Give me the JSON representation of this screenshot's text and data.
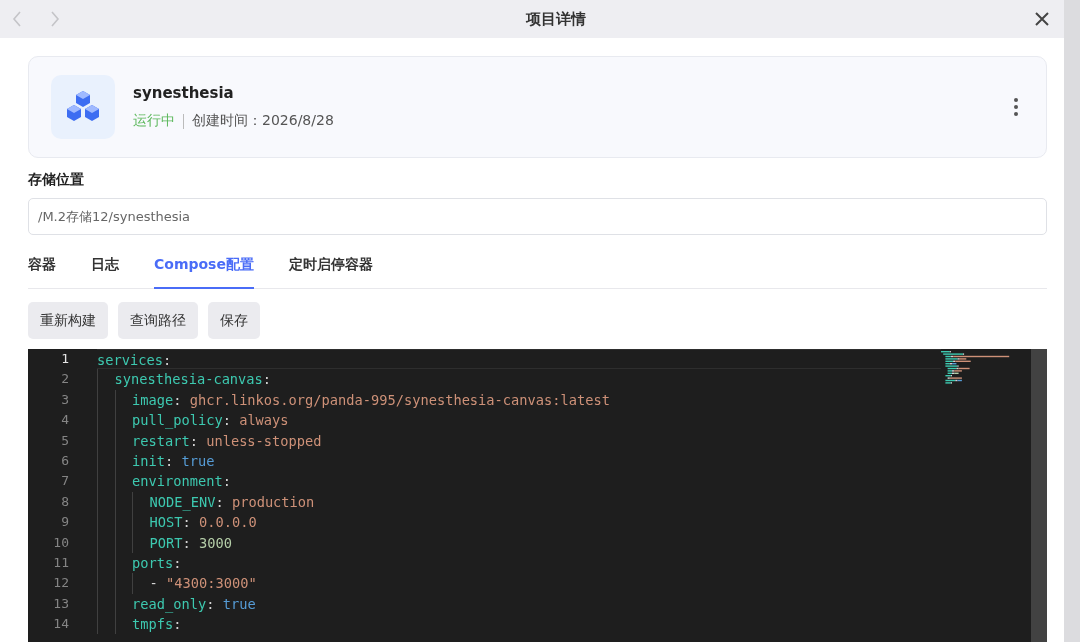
{
  "window": {
    "title": "项目详情"
  },
  "project": {
    "name": "synesthesia",
    "status": "运行中",
    "running": true,
    "created": "创建时间：2026/8/28"
  },
  "storage": {
    "label": "存储位置",
    "value": "/M.2存储12/synesthesia"
  },
  "tabs": [
    {
      "label": "容器",
      "selected": false
    },
    {
      "label": "日志",
      "selected": false
    },
    {
      "label": "Compose配置",
      "selected": true
    },
    {
      "label": "定时启停容器",
      "selected": false
    }
  ],
  "buttons": [
    "重新构建",
    "查询路径",
    "保存"
  ],
  "editor": {
    "lines": [
      {
        "number": "1",
        "current": true,
        "tokens": [
          {
            "kind": "key",
            "text": "services"
          },
          {
            "kind": "punct",
            "text": ":"
          }
        ],
        "children": [
          {
            "number": "2",
            "current": false,
            "tokens": [
              {
                "kind": "key",
                "text": "synesthesia-canvas"
              },
              {
                "kind": "punct",
                "text": ":"
              }
            ],
            "children": [
              {
                "number": "3",
                "current": false,
                "tokens": [
                  {
                    "kind": "key",
                    "text": "image"
                  },
                  {
                    "kind": "punct",
                    "text": ": "
                  },
                  {
                    "kind": "string",
                    "text": "ghcr.linkos.org/panda-995/synesthesia-canvas:latest"
                  }
                ]
              },
              {
                "number": "4",
                "current": false,
                "tokens": [
                  {
                    "kind": "key",
                    "text": "pull_policy"
                  },
                  {
                    "kind": "punct",
                    "text": ": "
                  },
                  {
                    "kind": "string",
                    "text": "always"
                  }
                ]
              },
              {
                "number": "5",
                "current": false,
                "tokens": [
                  {
                    "kind": "key",
                    "text": "restart"
                  },
                  {
                    "kind": "punct",
                    "text": ": "
                  },
                  {
                    "kind": "string",
                    "text": "unless-stopped"
                  }
                ]
              },
              {
                "number": "6",
                "current": false,
                "tokens": [
                  {
                    "kind": "key",
                    "text": "init"
                  },
                  {
                    "kind": "punct",
                    "text": ": "
                  },
                  {
                    "kind": "bool",
                    "text": "true"
                  }
                ]
              },
              {
                "number": "7",
                "current": false,
                "tokens": [
                  {
                    "kind": "key",
                    "text": "environment"
                  },
                  {
                    "kind": "punct",
                    "text": ":"
                  }
                ],
                "children": [
                  {
                    "number": "8",
                    "current": false,
                    "tokens": [
                      {
                        "kind": "key",
                        "text": "NODE_ENV"
                      },
                      {
                        "kind": "punct",
                        "text": ": "
                      },
                      {
                        "kind": "string",
                        "text": "production"
                      }
                    ]
                  },
                  {
                    "number": "9",
                    "current": false,
                    "tokens": [
                      {
                        "kind": "key",
                        "text": "HOST"
                      },
                      {
                        "kind": "punct",
                        "text": ": "
                      },
                      {
                        "kind": "string",
                        "text": "0.0.0.0"
                      }
                    ]
                  },
                  {
                    "number": "10",
                    "current": false,
                    "tokens": [
                      {
                        "kind": "key",
                        "text": "PORT"
                      },
                      {
                        "kind": "punct",
                        "text": ": "
                      },
                      {
                        "kind": "number",
                        "text": "3000"
                      }
                    ]
                  }
                ]
              },
              {
                "number": "11",
                "current": false,
                "tokens": [
                  {
                    "kind": "key",
                    "text": "ports"
                  },
                  {
                    "kind": "punct",
                    "text": ":"
                  }
                ],
                "children": [
                  {
                    "number": "12",
                    "current": false,
                    "tokens": [
                      {
                        "kind": "punct",
                        "text": "- "
                      },
                      {
                        "kind": "string",
                        "text": "\"4300:3000\""
                      }
                    ]
                  }
                ]
              },
              {
                "number": "13",
                "current": false,
                "tokens": [
                  {
                    "kind": "key",
                    "text": "read_only"
                  },
                  {
                    "kind": "punct",
                    "text": ": "
                  },
                  {
                    "kind": "bool",
                    "text": "true"
                  }
                ]
              },
              {
                "number": "14",
                "current": false,
                "tokens": [
                  {
                    "kind": "key",
                    "text": "tmpfs"
                  },
                  {
                    "kind": "punct",
                    "text": ":"
                  }
                ]
              }
            ]
          }
        ]
      }
    ]
  }
}
